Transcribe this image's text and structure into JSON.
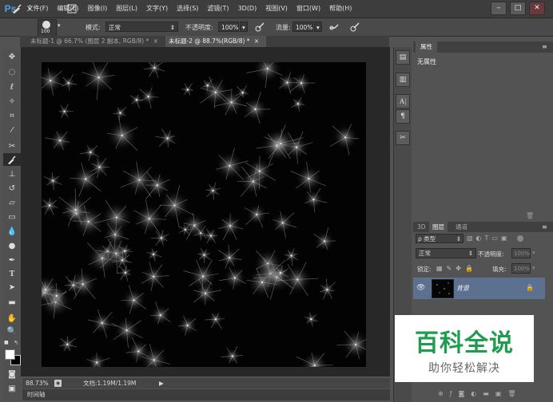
{
  "app": {
    "logo": "Ps"
  },
  "menu": [
    "文件(F)",
    "编辑(E)",
    "图像(I)",
    "图层(L)",
    "文字(Y)",
    "选择(S)",
    "滤镜(T)",
    "3D(D)",
    "视图(V)",
    "窗口(W)",
    "帮助(H)"
  ],
  "window_controls": {
    "minimize": "–",
    "restore": "□",
    "close": "✕"
  },
  "options": {
    "brush_size": "100",
    "mode_label": "模式:",
    "mode_value": "正常",
    "opacity_label": "不透明度:",
    "opacity_value": "100%",
    "flow_label": "流量:",
    "flow_value": "100%"
  },
  "tabs": [
    {
      "label": "未标题-1 @ 66.7% (图层 2 副本, RGB/8) *",
      "close": "×",
      "active": false
    },
    {
      "label": "未标题-2 @ 88.7%(RGB/8) *",
      "close": "×",
      "active": true
    }
  ],
  "status": {
    "zoom": "88.73%",
    "doc": "文档:1.19M/1.19M",
    "arrow": "▶"
  },
  "timeline": {
    "label": "时间轴"
  },
  "properties": {
    "tab": "属性",
    "no_props": "无属性"
  },
  "layers": {
    "tabs": [
      "3D",
      "图层",
      "通道"
    ],
    "filter_label": "类型",
    "blend_mode": "正常",
    "opacity_label": "不透明度:",
    "opacity_value": "100%",
    "lock_label": "锁定:",
    "fill_label": "填充:",
    "fill_value": "100%",
    "layer_name": "背景"
  },
  "watermark": {
    "title": "百科全说",
    "subtitle": "助你轻松解决"
  },
  "colors": {
    "watermark_green": "#1e9d4e",
    "selected_layer": "#5c7190"
  }
}
